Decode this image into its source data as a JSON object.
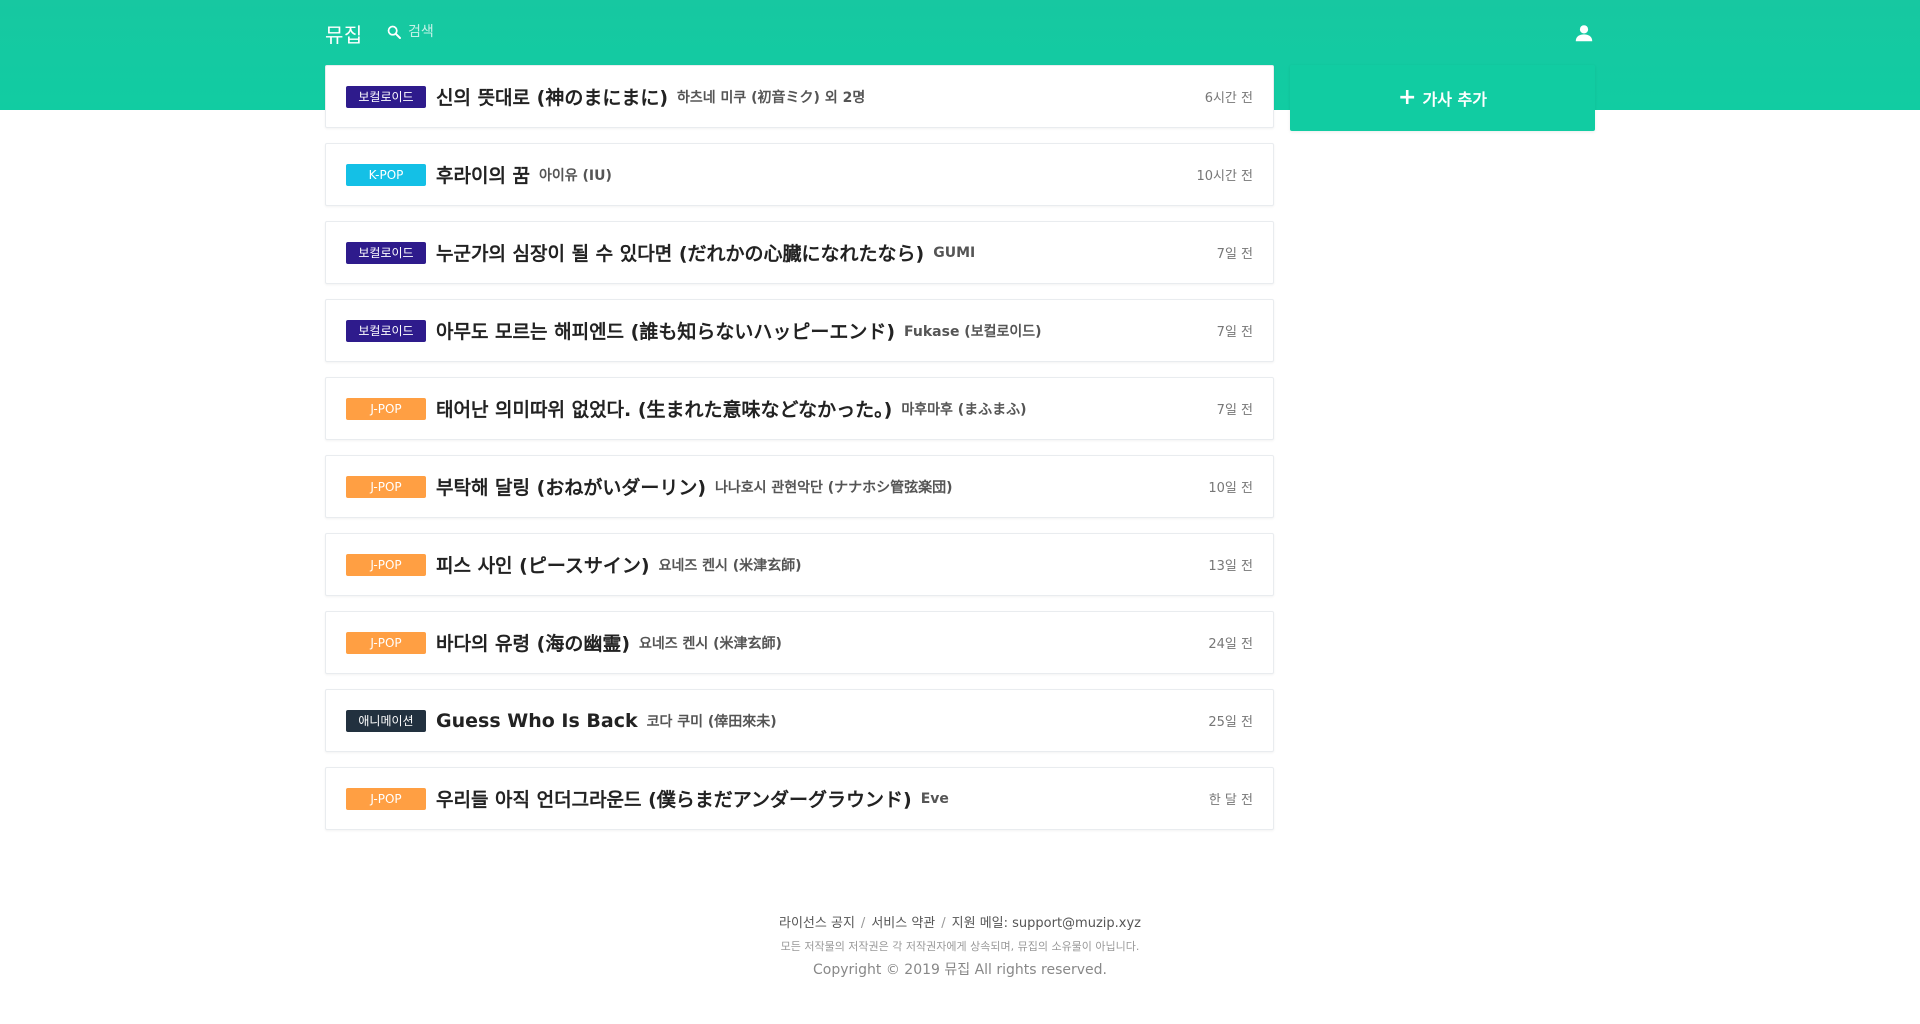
{
  "header": {
    "brand": "뮤집",
    "search_placeholder": "검색",
    "profile_icon": "person-icon"
  },
  "colors": {
    "accent": "#11cca2",
    "vocaloid": "#2e1b8c",
    "kpop": "#14c0e6",
    "jpop": "#ff9f43",
    "animation": "#22313f"
  },
  "add_button": {
    "label": "가사 추가",
    "icon": "plus-icon"
  },
  "songs": [
    {
      "genre": "보컬로이드",
      "genre_color": "#2e1b8c",
      "title": "신의 뜻대로 (神のまにまに)",
      "artist": "하츠네 미쿠 (初音ミク) 외 2명",
      "time": "6시간 전"
    },
    {
      "genre": "K-POP",
      "genre_color": "#14c0e6",
      "title": "후라이의 꿈",
      "artist": "아이유 (IU)",
      "time": "10시간 전"
    },
    {
      "genre": "보컬로이드",
      "genre_color": "#2e1b8c",
      "title": "누군가의 심장이 될 수 있다면 (だれかの心臓になれたなら)",
      "artist": "GUMI",
      "time": "7일 전"
    },
    {
      "genre": "보컬로이드",
      "genre_color": "#2e1b8c",
      "title": "아무도 모르는 해피엔드 (誰も知らないハッピーエンド)",
      "artist": "Fukase (보컬로이드)",
      "time": "7일 전"
    },
    {
      "genre": "J-POP",
      "genre_color": "#ff9f43",
      "title": "태어난 의미따위 없었다. (生まれた意味などなかった。)",
      "artist": "마후마후 (まふまふ)",
      "time": "7일 전"
    },
    {
      "genre": "J-POP",
      "genre_color": "#ff9f43",
      "title": "부탁해 달링 (おねがいダーリン)",
      "artist": "나나호시 관현악단 (ナナホシ管弦楽団)",
      "time": "10일 전"
    },
    {
      "genre": "J-POP",
      "genre_color": "#ff9f43",
      "title": "피스 사인 (ピースサイン)",
      "artist": "요네즈 켄시 (米津玄師)",
      "time": "13일 전"
    },
    {
      "genre": "J-POP",
      "genre_color": "#ff9f43",
      "title": "바다의 유령 (海の幽霊)",
      "artist": "요네즈 켄시 (米津玄師)",
      "time": "24일 전"
    },
    {
      "genre": "애니메이션",
      "genre_color": "#22313f",
      "title": "Guess Who Is Back",
      "artist": "코다 쿠미 (倖田來未)",
      "time": "25일 전"
    },
    {
      "genre": "J-POP",
      "genre_color": "#ff9f43",
      "title": "우리들 아직 언더그라운드 (僕らまだアンダーグラウンド)",
      "artist": "Eve",
      "time": "한 달 전"
    }
  ],
  "footer": {
    "links": [
      "라이선스 공지",
      "서비스 약관",
      "지원 메일: support@muzip.xyz"
    ],
    "notice": "모든 저작물의 저작권은 각 저작권자에게 상속되며, 뮤집의 소유물이 아닙니다.",
    "copyright": "Copyright © 2019 뮤집 All rights reserved."
  }
}
